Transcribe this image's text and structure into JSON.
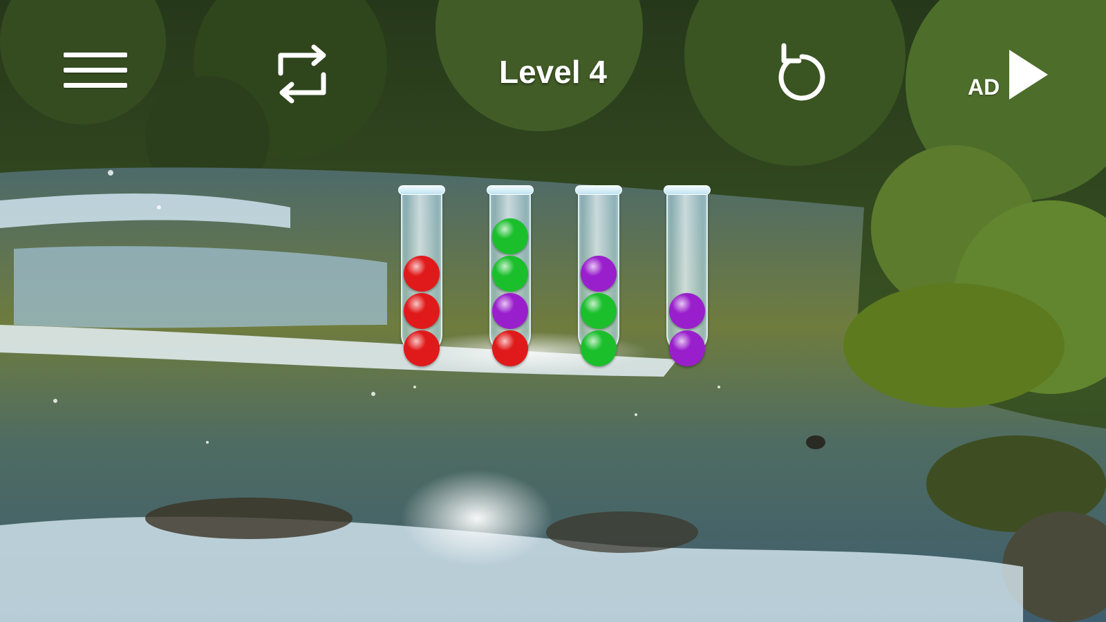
{
  "header": {
    "level_title": "Level 4",
    "ad_label": "AD"
  },
  "icons": {
    "menu": "hamburger-menu-icon",
    "swap": "swap-arrows-icon",
    "undo": "undo-icon",
    "ad_play": "play-triangle-icon"
  },
  "colors": {
    "red": "#e01a1a",
    "green": "#1bbf2c",
    "purple": "#9a1fcc",
    "ui_white": "#ffffff"
  },
  "tubes": [
    {
      "balls_top_to_bottom": [
        "red",
        "red",
        "red"
      ]
    },
    {
      "balls_top_to_bottom": [
        "green",
        "green",
        "purple",
        "red"
      ]
    },
    {
      "balls_top_to_bottom": [
        "purple",
        "green",
        "green"
      ]
    },
    {
      "balls_top_to_bottom": [
        "purple",
        "purple"
      ]
    }
  ],
  "tube_capacity": 4
}
